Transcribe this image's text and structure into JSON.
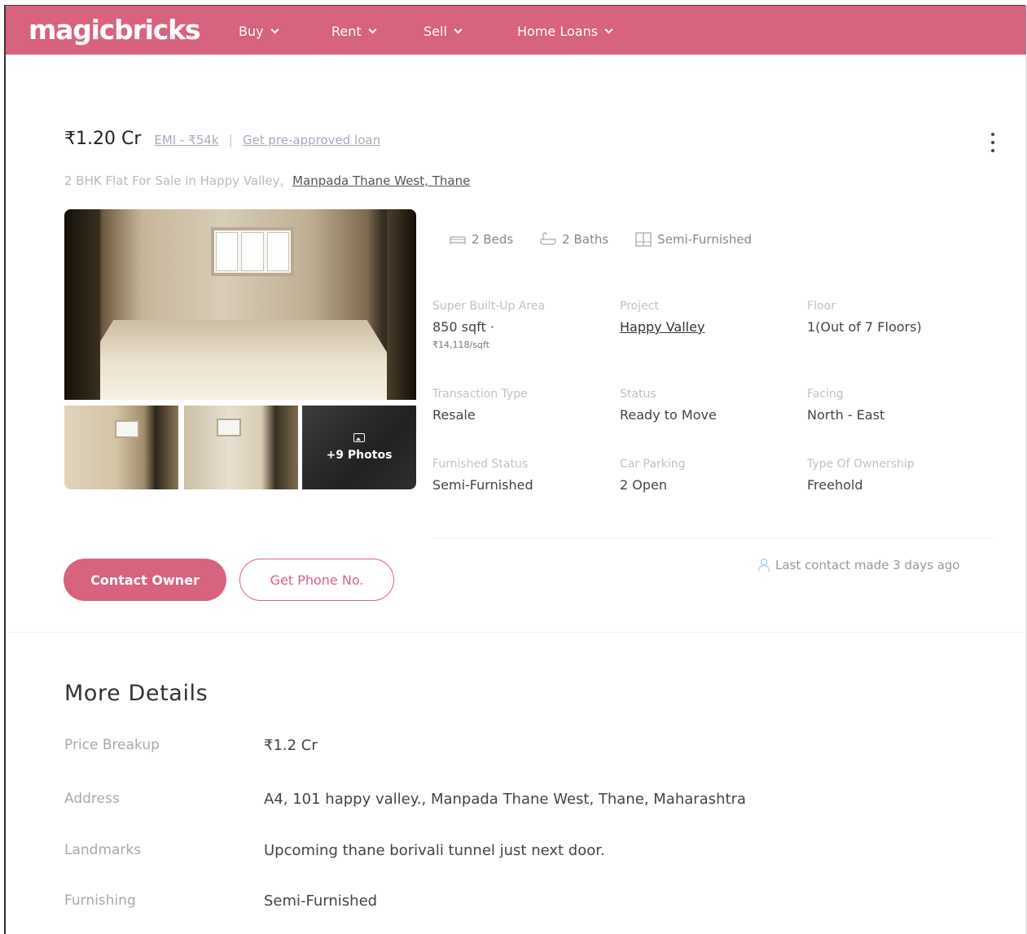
{
  "header": {
    "logo": "magicbricks",
    "nav": [
      {
        "label": "Buy"
      },
      {
        "label": "Rent"
      },
      {
        "label": "Sell"
      },
      {
        "label": "Home Loans"
      }
    ]
  },
  "listing": {
    "price": "₹1.20 Cr",
    "emi": "EMI - ₹54k",
    "pre_approved": "Get pre-approved loan",
    "title_prefix": "2 BHK Flat For Sale in Happy Valley,",
    "location_link": "Manpada Thane West, Thane",
    "photos_more": "+9 Photos",
    "amenities": {
      "beds": "2 Beds",
      "baths": "2 Baths",
      "furnishing": "Semi-Furnished"
    },
    "specs": {
      "area_label": "Super Built-Up Area",
      "area_value": "850 sqft ·",
      "area_rate": "₹14,118/sqft",
      "project_label": "Project",
      "project_value": "Happy Valley",
      "floor_label": "Floor",
      "floor_value": "1(Out of 7 Floors)",
      "transaction_label": "Transaction Type",
      "transaction_value": "Resale",
      "status_label": "Status",
      "status_value": "Ready to Move",
      "facing_label": "Facing",
      "facing_value": "North - East",
      "furnished_label": "Furnished Status",
      "furnished_value": "Semi-Furnished",
      "parking_label": "Car Parking",
      "parking_value": "2 Open",
      "ownership_label": "Type Of Ownership",
      "ownership_value": "Freehold"
    },
    "actions": {
      "contact_owner": "Contact Owner",
      "get_phone": "Get Phone No."
    },
    "last_contact": "Last contact made 3 days ago"
  },
  "more_details": {
    "title": "More Details",
    "rows": [
      {
        "label": "Price Breakup",
        "value": "₹1.2 Cr"
      },
      {
        "label": "Address",
        "value": "A4, 101 happy valley., Manpada Thane West, Thane, Maharashtra"
      },
      {
        "label": "Landmarks",
        "value": "Upcoming thane borivali tunnel just next door."
      },
      {
        "label": "Furnishing",
        "value": "Semi-Furnished"
      }
    ]
  },
  "colors": {
    "brand": "#d8637f",
    "text_muted": "#aaaaaa"
  }
}
